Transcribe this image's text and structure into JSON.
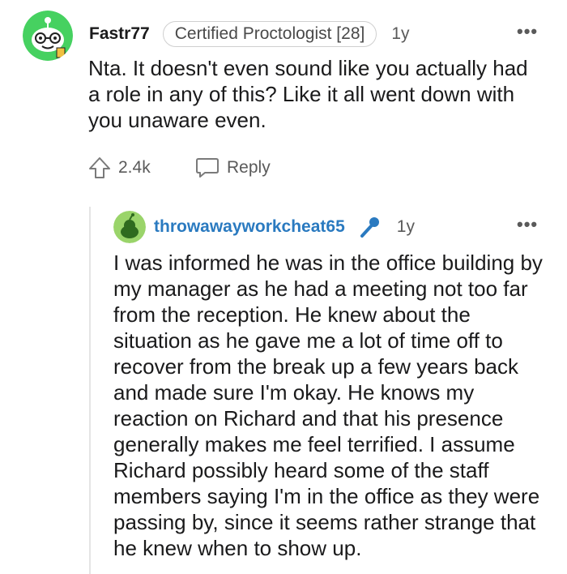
{
  "comment": {
    "username": "Fastr77",
    "flair": "Certified Proctologist [28]",
    "age": "1y",
    "more": "•••",
    "text": "Nta. It doesn't even sound like you actually had a role in any of this? Like it all went down with you unaware even.",
    "upvotes": "2.4k",
    "reply_label": "Reply"
  },
  "reply": {
    "username": "throwawayworkcheat65",
    "age": "1y",
    "more": "•••",
    "text": "I was informed he was in the office building by my manager as he had a meeting not too far from the reception. He knew about the situation as he gave me a lot of time off to recover from the break up a few years back and made sure I'm okay. He knows my reaction on Richard and that his presence generally makes me feel terrified. I assume Richard possibly heard some of the staff members saying I'm in the office as they were passing by, since it seems rather strange that he knew when to show up."
  },
  "icons": {
    "upvote": "arrow-up-icon",
    "reply": "speech-bubble-icon",
    "op_badge": "microphone-icon"
  },
  "colors": {
    "op_username": "#2a7ac0",
    "avatar_green": "#46d160",
    "text": "#1a1a1b",
    "muted": "#5a5a5a"
  }
}
